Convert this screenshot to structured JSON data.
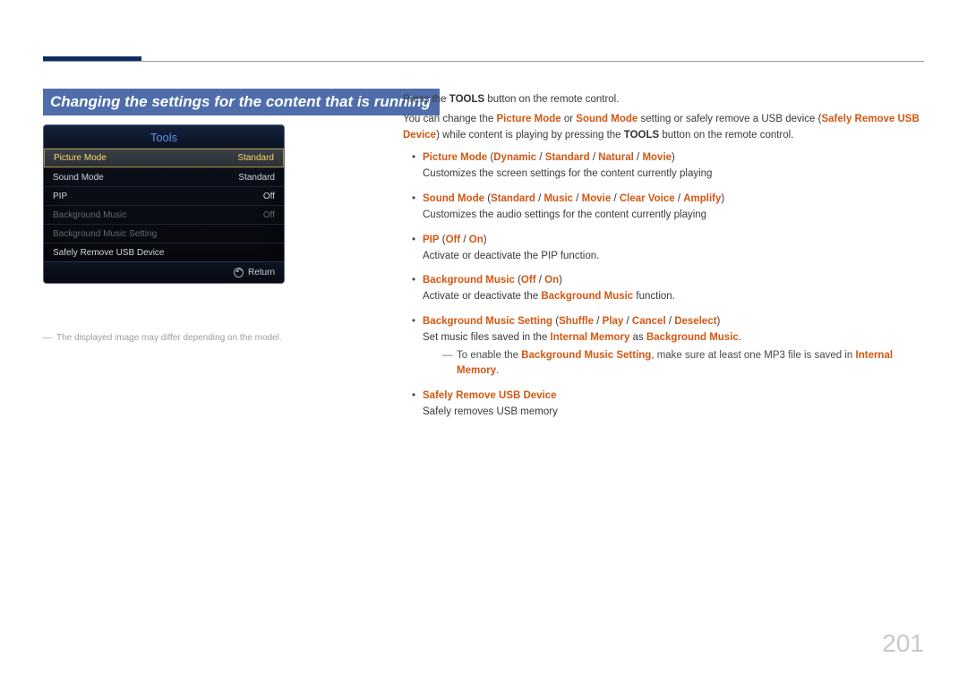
{
  "page_number": "201",
  "section_title": "Changing the settings for the content that is running",
  "tools_panel": {
    "title": "Tools",
    "rows": [
      {
        "label": "Picture Mode",
        "value": "Standard",
        "style": "highlight"
      },
      {
        "label": "Sound Mode",
        "value": "Standard",
        "style": ""
      },
      {
        "label": "PIP",
        "value": "Off",
        "style": ""
      },
      {
        "label": "Background Music",
        "value": "Off",
        "style": "dim"
      },
      {
        "label": "Background Music Setting",
        "value": "",
        "style": "dim"
      },
      {
        "label": "Safely Remove USB Device",
        "value": "",
        "style": ""
      }
    ],
    "footer": "Return"
  },
  "left_note": "The displayed image may differ depending on the model.",
  "intro": {
    "line1_pre": "Press the ",
    "line1_bold": "TOOLS",
    "line1_post": " button on the remote control.",
    "line2_a": "You can change the ",
    "line2_pm": "Picture Mode",
    "line2_or": " or ",
    "line2_sm": "Sound Mode",
    "line2_mid": " setting or safely remove a USB device (",
    "line2_sr": "Safely Remove USB Device",
    "line2_end": ") while content is playing by pressing the ",
    "line2_bold": "TOOLS",
    "line2_post": " button on the remote control."
  },
  "items": {
    "picture": {
      "head": "Picture Mode",
      "opts": [
        "Dynamic",
        "Standard",
        "Natural",
        "Movie"
      ],
      "desc": "Customizes the screen settings for the content currently playing"
    },
    "sound": {
      "head": "Sound Mode",
      "opts": [
        "Standard",
        "Music",
        "Movie",
        "Clear Voice",
        "Amplify"
      ],
      "desc": "Customizes the audio settings for the content currently playing"
    },
    "pip": {
      "head": "PIP",
      "opts": [
        "Off",
        "On"
      ],
      "desc": "Activate or deactivate the PIP function."
    },
    "bgm": {
      "head": "Background Music",
      "opts": [
        "Off",
        "On"
      ],
      "desc_pre": "Activate or deactivate the ",
      "desc_bold": "Background Music",
      "desc_post": " function."
    },
    "bgms": {
      "head": "Background Music Setting",
      "opts": [
        "Shuffle",
        "Play",
        "Cancel",
        "Deselect"
      ],
      "desc_pre": "Set music files saved in the ",
      "desc_b1": "Internal Memory",
      "desc_mid": " as ",
      "desc_b2": "Background Music",
      "desc_post": ".",
      "note_pre": "To enable the ",
      "note_b1": "Background Music Setting",
      "note_mid": ", make sure at least one MP3 file is saved in ",
      "note_b2": "Internal Memory",
      "note_post": "."
    },
    "safe": {
      "head": "Safely Remove USB Device",
      "desc": "Safely removes USB memory"
    }
  }
}
